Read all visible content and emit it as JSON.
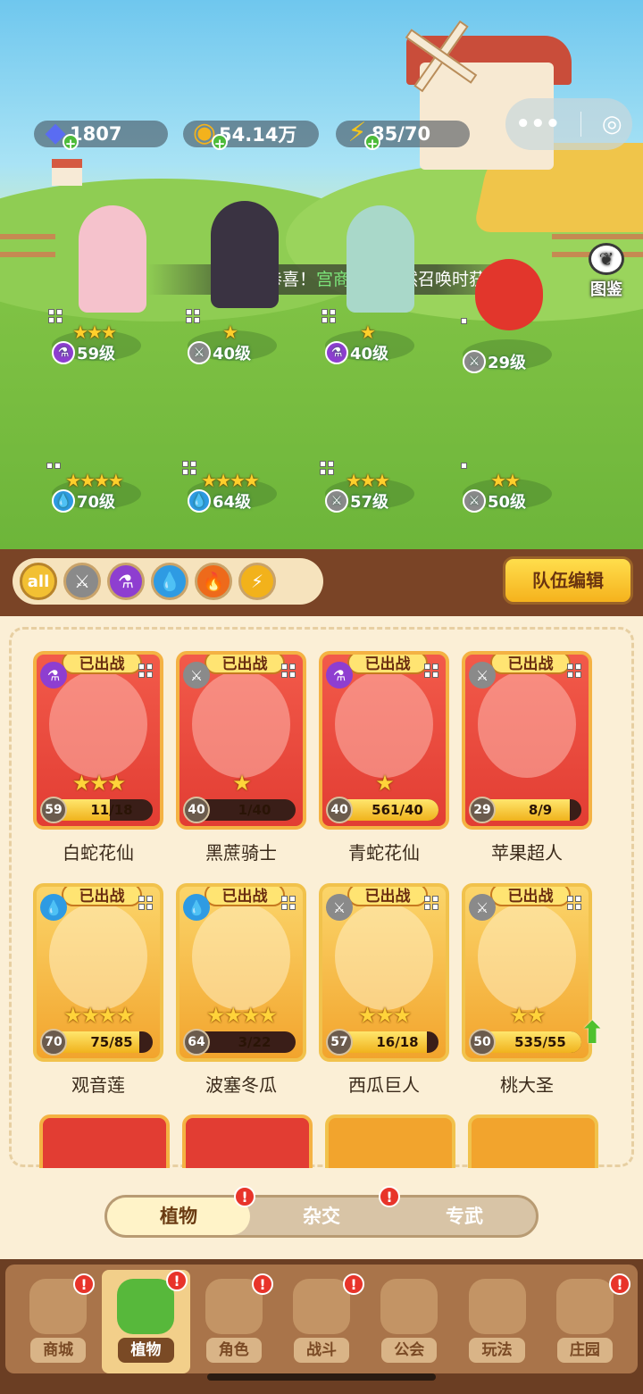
{
  "hud": {
    "diamonds": "1807",
    "coins": "54.14万",
    "energy": "85/70"
  },
  "collection_label": "图鉴",
  "broadcast": {
    "prefix": "恭喜！",
    "name": "宫商醒",
    "suffix": "在自然召唤时获"
  },
  "field_heroes": [
    {
      "stars": "★★★",
      "element": "poison",
      "level": "59级"
    },
    {
      "stars": "★",
      "element": "blade",
      "level": "40级"
    },
    {
      "stars": "★",
      "element": "poison",
      "level": "40级"
    },
    {
      "stars": "",
      "element": "blade",
      "level": "29级"
    },
    {
      "stars": "★★★★",
      "element": "water",
      "level": "70级"
    },
    {
      "stars": "★★★★",
      "element": "water",
      "level": "64级"
    },
    {
      "stars": "★★★",
      "element": "blade",
      "level": "57级"
    },
    {
      "stars": "★★",
      "element": "blade",
      "level": "50级"
    }
  ],
  "filters": [
    "all",
    "blade",
    "poison",
    "water",
    "fire",
    "electric"
  ],
  "filter_all_label": "all",
  "team_edit_label": "队伍编辑",
  "deployed_label": "已出战",
  "cards": [
    {
      "name": "白蛇花仙",
      "level": "59",
      "progress": "11/18",
      "ratio": 0.61,
      "stars": "★★★",
      "element": "poison",
      "frame": "red"
    },
    {
      "name": "黑蔗骑士",
      "level": "40",
      "progress": "1/40",
      "ratio": 0.03,
      "stars": "★",
      "element": "blade",
      "frame": "red"
    },
    {
      "name": "青蛇花仙",
      "level": "40",
      "progress": "561/40",
      "ratio": 1.0,
      "stars": "★",
      "element": "poison",
      "frame": "red"
    },
    {
      "name": "苹果超人",
      "level": "29",
      "progress": "8/9",
      "ratio": 0.89,
      "stars": "",
      "element": "blade",
      "frame": "red"
    },
    {
      "name": "观音莲",
      "level": "70",
      "progress": "75/85",
      "ratio": 0.88,
      "stars": "★★★★",
      "element": "water",
      "frame": "gold"
    },
    {
      "name": "波塞冬瓜",
      "level": "64",
      "progress": "3/22",
      "ratio": 0.14,
      "stars": "★★★★",
      "element": "water",
      "frame": "gold"
    },
    {
      "name": "西瓜巨人",
      "level": "57",
      "progress": "16/18",
      "ratio": 0.89,
      "stars": "★★★",
      "element": "blade",
      "frame": "gold"
    },
    {
      "name": "桃大圣",
      "level": "50",
      "progress": "535/55",
      "ratio": 1.0,
      "stars": "★★",
      "element": "blade",
      "frame": "gold"
    }
  ],
  "tabs": [
    "植物",
    "杂交",
    "专武"
  ],
  "nav": [
    "商城",
    "植物",
    "角色",
    "战斗",
    "公会",
    "玩法",
    "庄园"
  ],
  "colors": {
    "accent": "#f5b21d",
    "brown": "#7a4426",
    "card_red": "#e23d33",
    "card_gold": "#f2a42d"
  }
}
